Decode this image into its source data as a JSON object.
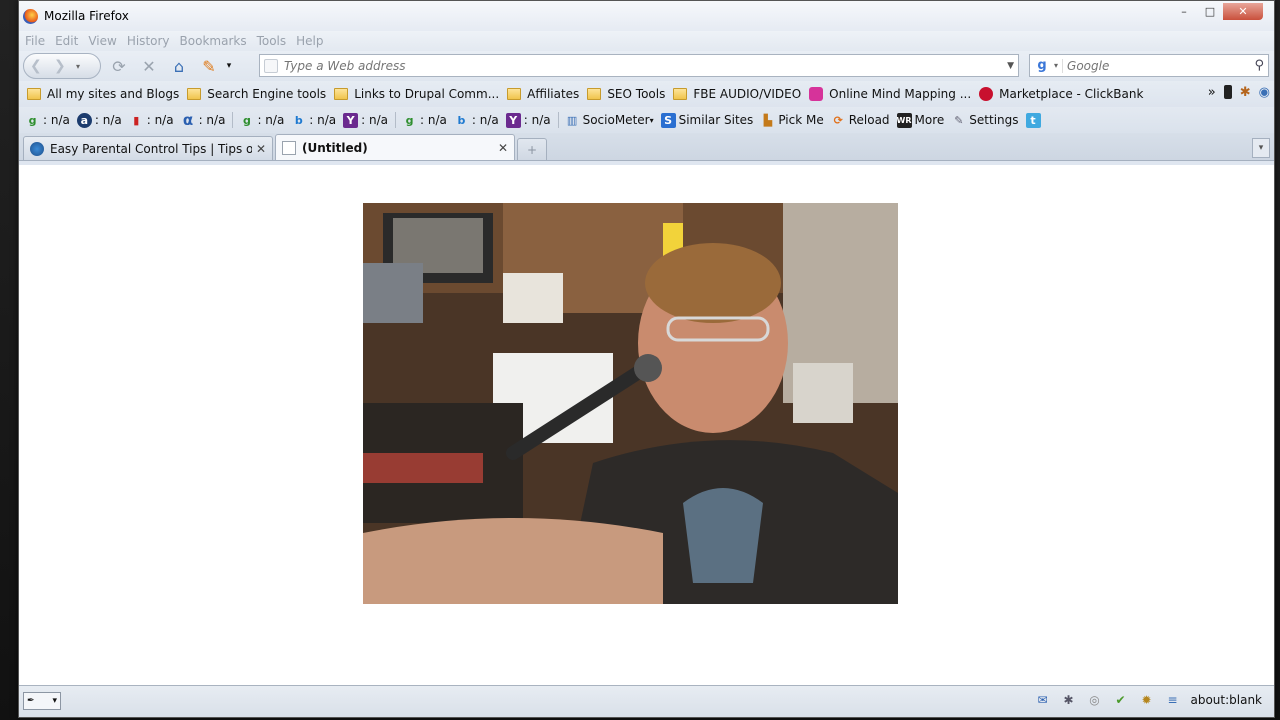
{
  "window": {
    "title": "Mozilla Firefox",
    "controls": {
      "minimize": "–",
      "maximize": "□",
      "close": "✕"
    }
  },
  "menu": [
    "File",
    "Edit",
    "View",
    "History",
    "Bookmarks",
    "Tools",
    "Help"
  ],
  "nav": {
    "url_placeholder": "Type a Web address",
    "search_placeholder": "Google",
    "search_engine_letter": "g"
  },
  "bookmarks": [
    "All my sites and Blogs",
    "Search Engine tools",
    "Links to Drupal Comm...",
    "Affiliates",
    "SEO Tools",
    "FBE AUDIO/VIDEO",
    "Online Mind Mapping ...",
    "Marketplace - ClickBank"
  ],
  "bookmarks_overflow": "»",
  "addon": {
    "na": ": n/a",
    "sociometer": "SocioMeter",
    "similar": "Similar Sites",
    "pickme": "Pick Me",
    "reload": "Reload",
    "more": "More",
    "settings": "Settings"
  },
  "tabs": [
    {
      "label": "Easy Parental Control Tips | Tips on ...",
      "close": "✕"
    },
    {
      "label": "(Untitled)",
      "close": "✕"
    }
  ],
  "status": {
    "url": "about:blank"
  },
  "icons": {
    "back": "arrow-left-icon",
    "forward": "arrow-right-icon",
    "reload": "reload-icon",
    "stop": "stop-icon",
    "home": "home-icon"
  }
}
